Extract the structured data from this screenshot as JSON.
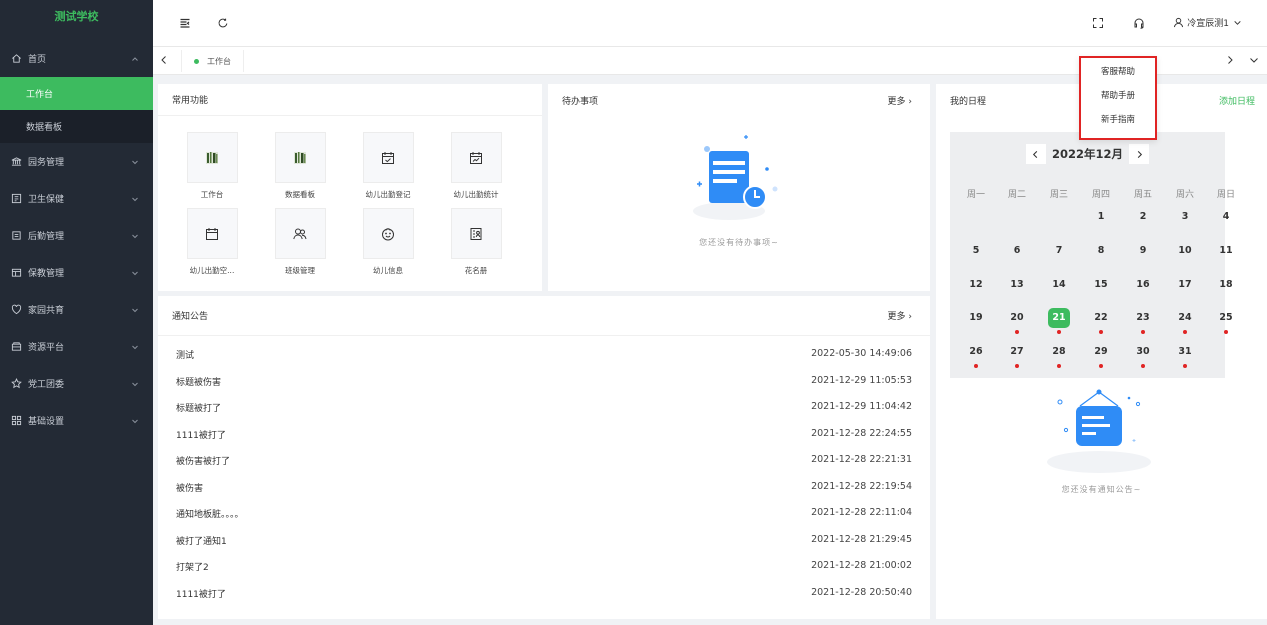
{
  "sidebar": {
    "logo": "测试学校",
    "home": "首页",
    "sub_items": [
      "工作台",
      "数据看板"
    ],
    "menu": [
      "园务管理",
      "卫生保健",
      "后勤管理",
      "保教管理",
      "家园共育",
      "资源平台",
      "党工团委",
      "基础设置"
    ]
  },
  "header": {
    "user_name": "冷宣辰测1",
    "dropdown": [
      "客服帮助",
      "帮助手册",
      "新手指南"
    ]
  },
  "tabs": {
    "active": "工作台"
  },
  "common_functions": {
    "title": "常用功能",
    "items": [
      "工作台",
      "数据看板",
      "幼儿出勤登记",
      "幼儿出勤统计",
      "幼儿出勤空...",
      "班级管理",
      "幼儿信息",
      "花名册"
    ]
  },
  "todo": {
    "title": "待办事项",
    "more": "更多",
    "empty": "您还没有待办事项~"
  },
  "notices": {
    "title": "通知公告",
    "more": "更多",
    "rows": [
      {
        "title": "测试",
        "time": "2022-05-30 14:49:06"
      },
      {
        "title": "标题被伤害",
        "time": "2021-12-29 11:05:53"
      },
      {
        "title": "标题被打了",
        "time": "2021-12-29 11:04:42"
      },
      {
        "title": "1111被打了",
        "time": "2021-12-28 22:24:55"
      },
      {
        "title": "被伤害被打了",
        "time": "2021-12-28 22:21:31"
      },
      {
        "title": "被伤害",
        "time": "2021-12-28 22:19:54"
      },
      {
        "title": "通知地板脏。。。。",
        "time": "2021-12-28 22:11:04"
      },
      {
        "title": "被打了通知1",
        "time": "2021-12-28 21:29:45"
      },
      {
        "title": "打架了2",
        "time": "2021-12-28 21:00:02"
      },
      {
        "title": "1111被打了",
        "time": "2021-12-28 20:50:40"
      }
    ]
  },
  "schedule": {
    "title": "我的日程",
    "add": "添加日程",
    "month": "2022年12月",
    "weekdays": [
      "周一",
      "周二",
      "周三",
      "周四",
      "周五",
      "周六",
      "周日"
    ],
    "first_weekday_index": 3,
    "days_in_month": 31,
    "today": 21,
    "event_days": [
      20,
      21,
      22,
      23,
      24,
      25,
      26,
      27,
      28,
      29,
      30,
      31
    ],
    "empty": "您还没有通知公告~"
  },
  "colors": {
    "accent": "#3dbb5f",
    "sidebar_bg": "#232a35",
    "event_dot": "#e02424"
  }
}
